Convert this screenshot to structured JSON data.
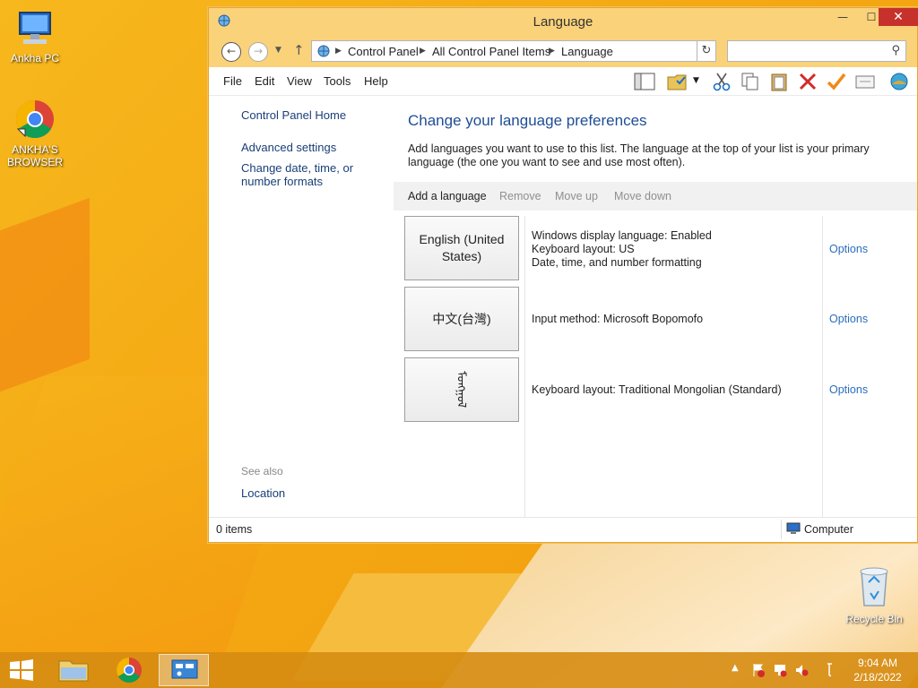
{
  "desktop": {
    "icons": [
      {
        "label": "Ankha PC"
      },
      {
        "label": "ANKHA'S BROWSER"
      },
      {
        "label": "Recycle Bin"
      }
    ]
  },
  "window": {
    "title": "Language",
    "close_glyph": "✕",
    "minimize_glyph": "—",
    "maximize_glyph": "☐",
    "address": {
      "breadcrumbs": [
        "Control Panel",
        "All Control Panel Items",
        "Language"
      ],
      "search_placeholder": ""
    },
    "menu": [
      "File",
      "Edit",
      "View",
      "Tools",
      "Help"
    ],
    "toolbar_icons": [
      "layout-icon",
      "folder-check-icon",
      "cut-icon",
      "copy-icon",
      "paste-icon",
      "delete-icon",
      "check-icon",
      "properties-icon",
      "globe-icon"
    ],
    "left_pane": {
      "links": [
        "Control Panel Home",
        "Advanced settings",
        "Change date, time, or number formats"
      ],
      "see_also": "See also",
      "see_also_links": [
        "Location"
      ]
    },
    "main": {
      "heading": "Change your language preferences",
      "description": "Add languages you want to use to this list. The language at the top of your list is your primary language (the one you want to see and use most often).",
      "toolbar": {
        "add": "Add a language",
        "remove": "Remove",
        "move_up": "Move up",
        "move_down": "Move down"
      },
      "languages": [
        {
          "name": "English (United States)",
          "details": [
            "Windows display language: Enabled",
            "Keyboard layout: US",
            "Date, time, and number formatting"
          ],
          "options": "Options"
        },
        {
          "name": "中文(台灣)",
          "details": [
            "Input method: Microsoft Bopomofo"
          ],
          "options": "Options"
        },
        {
          "name": "ᠮᠣᠩᠭᠣᠯ",
          "details": [
            "Keyboard layout: Traditional Mongolian (Standard)"
          ],
          "options": "Options"
        }
      ]
    },
    "status": {
      "items": "0 items",
      "location": "Computer"
    }
  },
  "taskbar": {
    "time": "9:04 AM",
    "date": "2/18/2022"
  },
  "colors": {
    "accent": "#fad27a",
    "link": "#2a6ebd",
    "heading": "#1e4d96",
    "close": "#c7312b"
  }
}
